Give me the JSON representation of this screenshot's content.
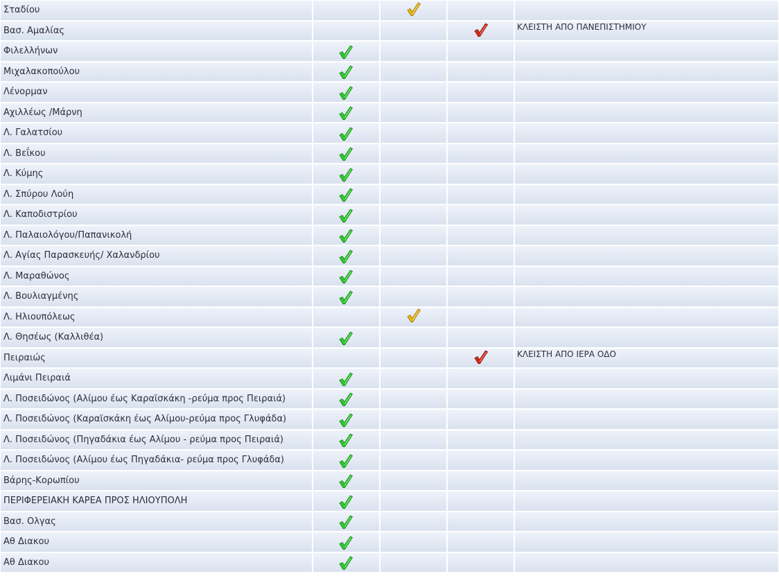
{
  "status_colors": {
    "green": "#2ecc2e",
    "yellow": "#e8b214",
    "red": "#d62a1e"
  },
  "status_icons": {
    "green": "check-green-icon",
    "yellow": "check-yellow-icon",
    "red": "check-red-icon"
  },
  "rows": [
    {
      "road": "Σταδίου",
      "status": "yellow",
      "note": ""
    },
    {
      "road": "Βασ. Αμαλίας",
      "status": "red",
      "note": "ΚΛΕΙΣΤΗ ΑΠΟ ΠΑΝΕΠΙΣΤΗΜΙΟΥ"
    },
    {
      "road": "Φιλελλήνων",
      "status": "green",
      "note": ""
    },
    {
      "road": "Μιχαλακοπούλου",
      "status": "green",
      "note": ""
    },
    {
      "road": "Λένορμαν",
      "status": "green",
      "note": ""
    },
    {
      "road": "Αχιλλέως /Μάρνη",
      "status": "green",
      "note": ""
    },
    {
      "road": "Λ. Γαλατσίου",
      "status": "green",
      "note": ""
    },
    {
      "road": "Λ. Βεΐκου",
      "status": "green",
      "note": ""
    },
    {
      "road": "Λ. Κύμης",
      "status": "green",
      "note": ""
    },
    {
      "road": "Λ. Σπύρου Λούη",
      "status": "green",
      "note": ""
    },
    {
      "road": "Λ. Καποδιστρίου",
      "status": "green",
      "note": ""
    },
    {
      "road": "Λ. Παλαιολόγου/Παπανικολή",
      "status": "green",
      "note": ""
    },
    {
      "road": "Λ. Αγίας Παρασκευής/ Χαλανδρίου",
      "status": "green",
      "note": ""
    },
    {
      "road": "Λ. Μαραθώνος",
      "status": "green",
      "note": ""
    },
    {
      "road": "Λ. Βουλιαγμένης",
      "status": "green",
      "note": ""
    },
    {
      "road": "Λ. Ηλιουπόλεως",
      "status": "yellow",
      "note": ""
    },
    {
      "road": "Λ. Θησέως (Καλλιθέα)",
      "status": "green",
      "note": ""
    },
    {
      "road": "Πειραιώς",
      "status": "red",
      "note": "ΚΛΕΙΣΤΗ ΑΠΟ ΙΕΡΑ ΟΔΟ"
    },
    {
      "road": "Λιμάνι Πειραιά",
      "status": "green",
      "note": ""
    },
    {
      "road": "Λ. Ποσειδώνος (Αλίμου έως Καραϊσκάκη -ρεύμα προς Πειραιά)",
      "status": "green",
      "note": ""
    },
    {
      "road": "Λ. Ποσειδώνος (Καραϊσκάκη έως Αλίμου-ρεύμα προς Γλυφάδα)",
      "status": "green",
      "note": ""
    },
    {
      "road": "Λ. Ποσειδώνος (Πηγαδάκια έως Αλίμου - ρεύμα προς Πειραιά)",
      "status": "green",
      "note": ""
    },
    {
      "road": "Λ. Ποσειδώνος (Αλίμου έως Πηγαδάκια- ρεύμα προς Γλυφάδα)",
      "status": "green",
      "note": ""
    },
    {
      "road": "Βάρης-Κορωπίου",
      "status": "green",
      "note": ""
    },
    {
      "road": "ΠΕΡΙΦΕΡΕΙΑΚΗ ΚΑΡΕΑ ΠΡΟΣ ΗΛΙΟΥΠΟΛΗ",
      "status": "green",
      "note": ""
    },
    {
      "road": "Βασ. Ολγας",
      "status": "green",
      "note": ""
    },
    {
      "road": "Αθ Διακου",
      "status": "green",
      "note": ""
    },
    {
      "road": "Αθ Διακου",
      "status": "green",
      "note": ""
    }
  ]
}
